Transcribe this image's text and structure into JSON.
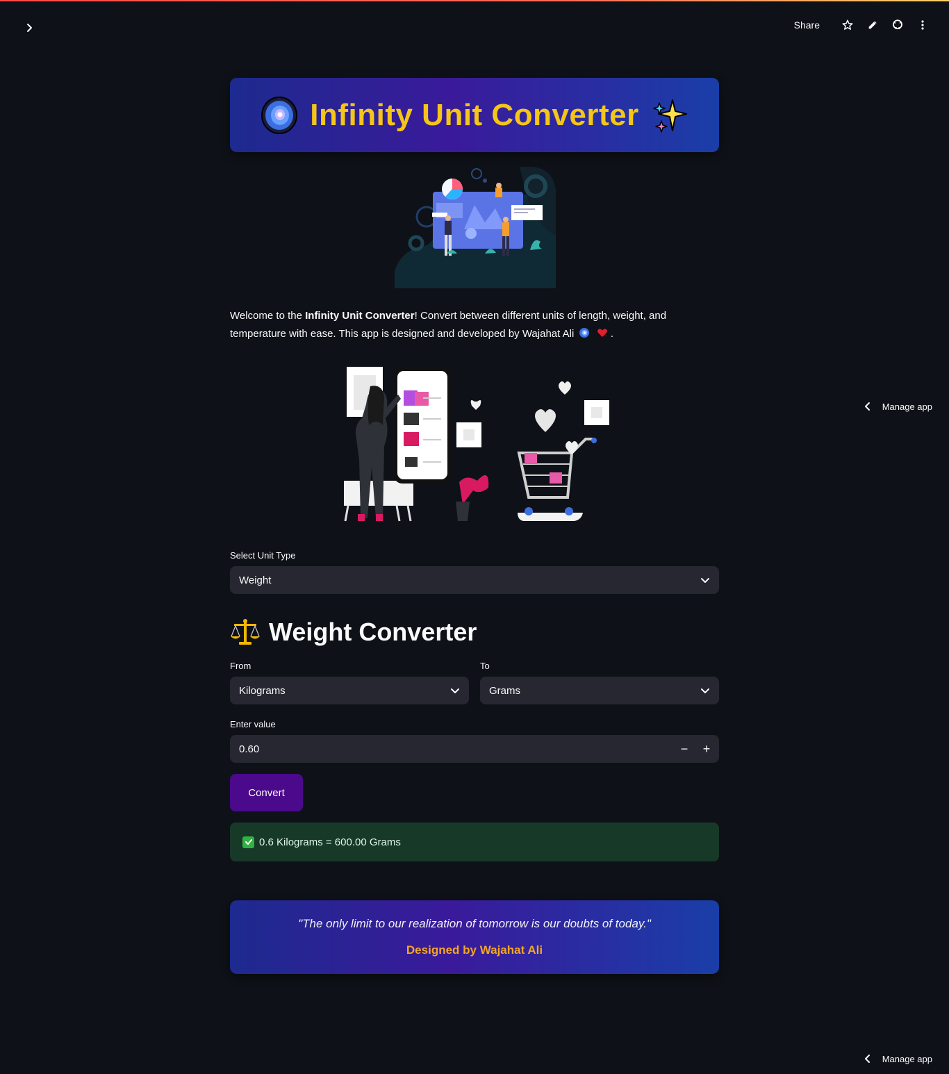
{
  "toolbar": {
    "share_label": "Share",
    "icons": [
      "star-icon",
      "edit-icon",
      "github-icon",
      "more-vert-icon"
    ]
  },
  "header": {
    "title": "Infinity Unit Converter",
    "left_emoji": "galaxy-icon",
    "right_emoji": "sparkles-icon"
  },
  "welcome": {
    "prefix": "Welcome to the ",
    "bold": "Infinity Unit Converter",
    "suffix": "! Convert between different units of length, weight, and temperature with ease. This app is designed and developed by Wajahat Ali",
    "end": " ."
  },
  "unit_type": {
    "label": "Select Unit Type",
    "value": "Weight"
  },
  "section": {
    "title": "Weight Converter",
    "icon": "scales-icon"
  },
  "from": {
    "label": "From",
    "value": "Kilograms"
  },
  "to": {
    "label": "To",
    "value": "Grams"
  },
  "value_input": {
    "label": "Enter value",
    "value": "0.60",
    "minus": "−",
    "plus": "+"
  },
  "convert": {
    "label": "Convert"
  },
  "result": {
    "text": "0.6 Kilograms = 600.00 Grams"
  },
  "footer": {
    "quote": "\"The only limit to our realization of tomorrow is our doubts of today.\"",
    "credit": "Designed by Wajahat Ali"
  },
  "manage_app": {
    "label": "Manage app"
  },
  "colors": {
    "background": "#0e1117",
    "banner_start": "#1d2a8f",
    "banner_mid": "#3a1a9a",
    "banner_end": "#1a3ea8",
    "title_gold": "#f5c518",
    "convert_button": "#4b0a8c",
    "success_bg": "#173928",
    "credit_orange": "#f5a623"
  }
}
